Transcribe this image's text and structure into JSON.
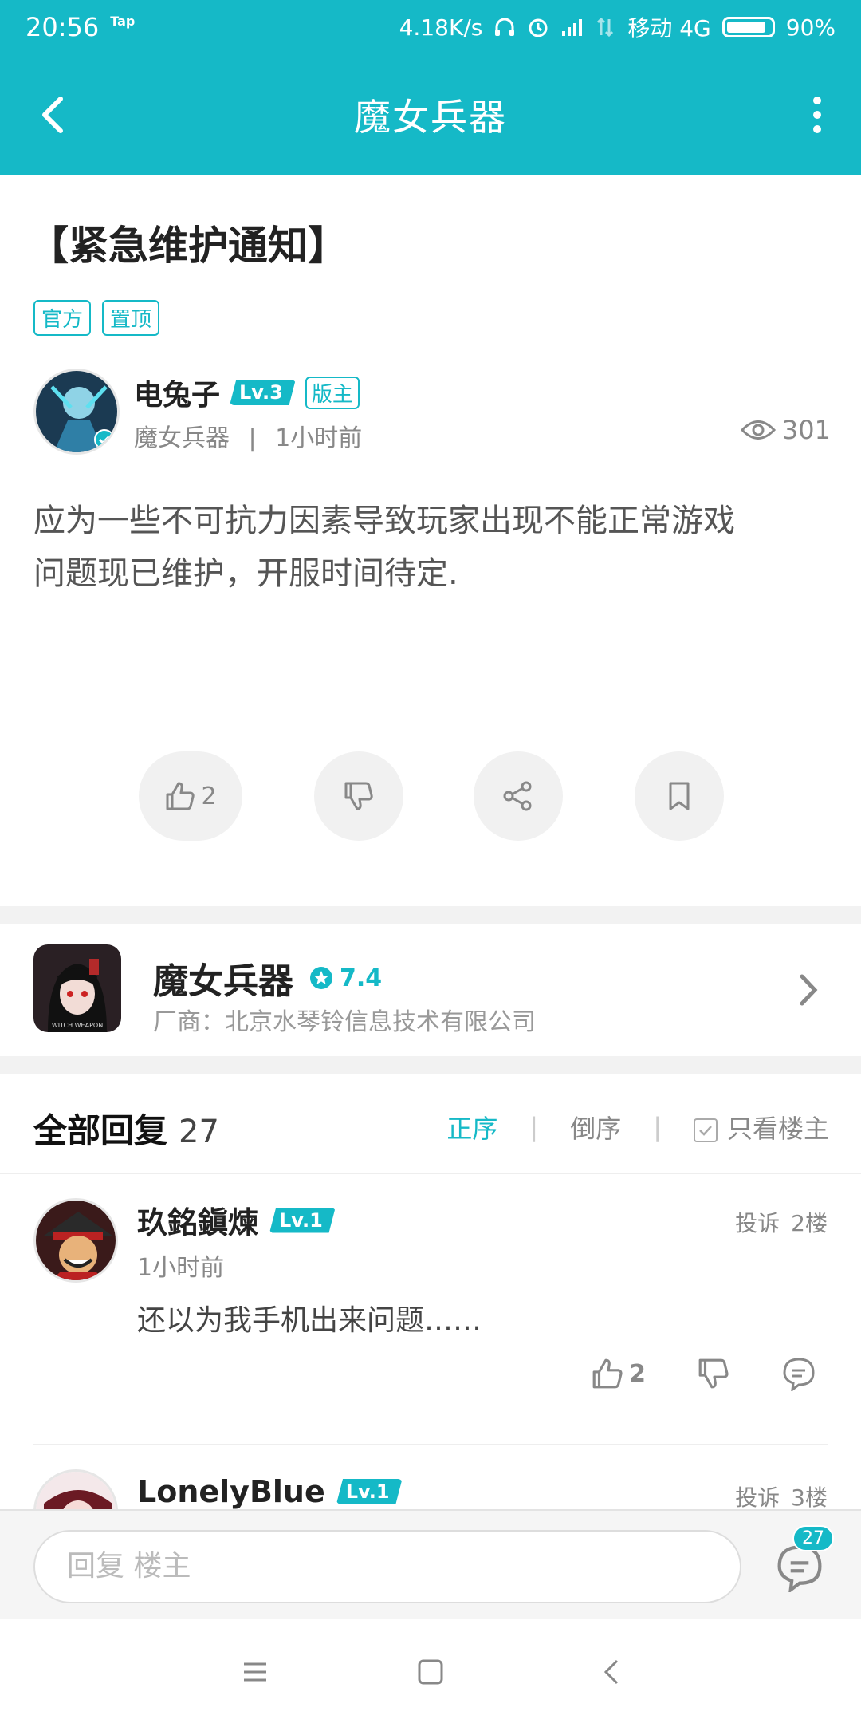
{
  "status_bar": {
    "time": "20:56",
    "tap_label": "Tap",
    "speed": "4.18K/s",
    "carrier": "移动 4G",
    "battery": "90%"
  },
  "nav": {
    "title": "魔女兵器"
  },
  "post": {
    "title": "【紧急维护通知】",
    "tags": [
      "官方",
      "置顶"
    ],
    "author": {
      "name": "电兔子",
      "level": "Lv.3",
      "role": "版主",
      "forum": "魔女兵器",
      "separator": "|",
      "time": "1小时前",
      "views": "301"
    },
    "content_line1": "应为一些不可抗力因素导致玩家出现不能正常游戏",
    "content_line2": "问题现已维护，开服时间待定.",
    "like_count": "2"
  },
  "game": {
    "name": "魔女兵器",
    "score": "7.4",
    "vendor": "厂商：北京水琴铃信息技术有限公司",
    "icon_caption": "WITCH WEAPON"
  },
  "replies": {
    "label": "全部回复",
    "count": "27",
    "sort_asc": "正序",
    "sort_desc": "倒序",
    "only_owner": "只看楼主",
    "items": [
      {
        "name": "玖銘鎭煉",
        "level": "Lv.1",
        "report": "投诉",
        "floor": "2楼",
        "time": "1小时前",
        "text": "还以为我手机出来问题……",
        "likes": "2"
      },
      {
        "name": "LonelyBlue",
        "level": "Lv.1",
        "report": "投诉",
        "floor": "3楼"
      }
    ]
  },
  "input": {
    "placeholder": "回复  楼主",
    "comment_badge": "27"
  },
  "colors": {
    "accent": "#15b9c7",
    "bg_gap": "#f2f2f2"
  }
}
